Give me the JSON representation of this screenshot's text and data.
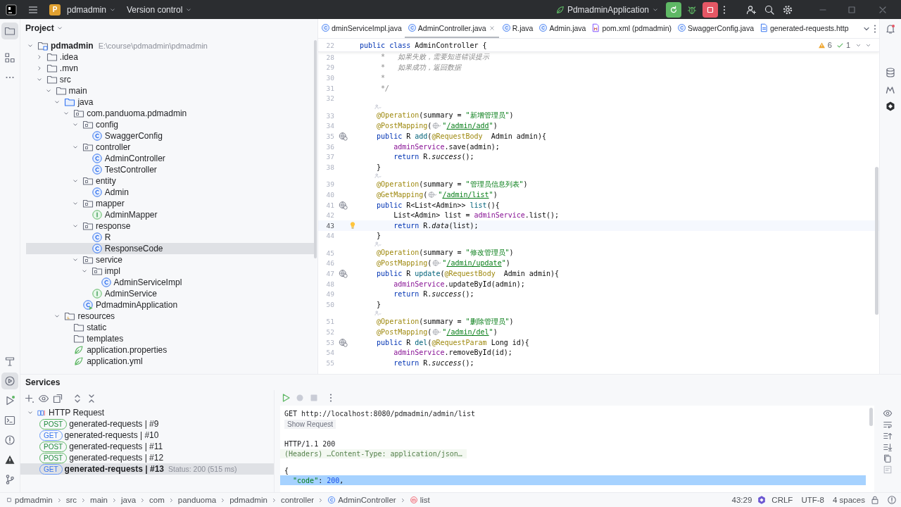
{
  "titlebar": {
    "project_initial": "P",
    "project": "pdmadmin",
    "vcs": "Version control",
    "run_config": "PdmadminApplication"
  },
  "project": {
    "title": "Project",
    "tree": [
      {
        "name": "pdmadmin",
        "path": "E:\\course\\pdmadmin\\pdmadmin",
        "kind": "module",
        "expanded": true,
        "selected": false,
        "children": [
          {
            "name": ".idea",
            "kind": "folder",
            "expanded": false,
            "selected": false
          },
          {
            "name": ".mvn",
            "kind": "folder",
            "expanded": false,
            "selected": false
          },
          {
            "name": "src",
            "kind": "folder",
            "expanded": true,
            "selected": false,
            "children": [
              {
                "name": "main",
                "kind": "folder",
                "expanded": true,
                "selected": false,
                "children": [
                  {
                    "name": "java",
                    "kind": "source",
                    "expanded": true,
                    "selected": false,
                    "children": [
                      {
                        "name": "com.panduoma.pdmadmin",
                        "kind": "package",
                        "expanded": true,
                        "selected": false,
                        "children": [
                          {
                            "name": "config",
                            "kind": "package",
                            "expanded": true,
                            "selected": false,
                            "children": [
                              {
                                "name": "SwaggerConfig",
                                "kind": "class",
                                "selected": false
                              }
                            ]
                          },
                          {
                            "name": "controller",
                            "kind": "package",
                            "expanded": true,
                            "selected": false,
                            "children": [
                              {
                                "name": "AdminController",
                                "kind": "class",
                                "selected": false
                              },
                              {
                                "name": "TestController",
                                "kind": "class",
                                "selected": false
                              }
                            ]
                          },
                          {
                            "name": "entity",
                            "kind": "package",
                            "expanded": true,
                            "selected": false,
                            "children": [
                              {
                                "name": "Admin",
                                "kind": "class",
                                "selected": false
                              }
                            ]
                          },
                          {
                            "name": "mapper",
                            "kind": "package",
                            "expanded": true,
                            "selected": false,
                            "children": [
                              {
                                "name": "AdminMapper",
                                "kind": "interface",
                                "selected": false
                              }
                            ]
                          },
                          {
                            "name": "response",
                            "kind": "package",
                            "expanded": true,
                            "selected": false,
                            "children": [
                              {
                                "name": "R",
                                "kind": "class",
                                "selected": false
                              },
                              {
                                "name": "ResponseCode",
                                "kind": "class",
                                "selected": true
                              }
                            ]
                          },
                          {
                            "name": "service",
                            "kind": "package",
                            "expanded": true,
                            "selected": false,
                            "children": [
                              {
                                "name": "impl",
                                "kind": "package",
                                "expanded": true,
                                "selected": false,
                                "children": [
                                  {
                                    "name": "AdminServiceImpl",
                                    "kind": "class",
                                    "selected": false
                                  }
                                ]
                              },
                              {
                                "name": "AdminService",
                                "kind": "interface",
                                "selected": false
                              }
                            ]
                          },
                          {
                            "name": "PdmadminApplication",
                            "kind": "app",
                            "selected": false
                          }
                        ]
                      }
                    ]
                  },
                  {
                    "name": "resources",
                    "kind": "resources",
                    "expanded": true,
                    "selected": false,
                    "children": [
                      {
                        "name": "static",
                        "kind": "folder",
                        "selected": false
                      },
                      {
                        "name": "templates",
                        "kind": "folder",
                        "selected": false
                      },
                      {
                        "name": "application.properties",
                        "kind": "config",
                        "selected": false
                      },
                      {
                        "name": "application.yml",
                        "kind": "config",
                        "selected": false
                      }
                    ]
                  }
                ]
              }
            ]
          }
        ]
      }
    ]
  },
  "editor": {
    "tabs": [
      {
        "label": "dminServiceImpl.java",
        "kind": "class",
        "selected": false
      },
      {
        "label": "AdminController.java",
        "kind": "class",
        "selected": true
      },
      {
        "label": "R.java",
        "kind": "class",
        "selected": false
      },
      {
        "label": "Admin.java",
        "kind": "class",
        "selected": false
      },
      {
        "label": "pom.xml (pdmadmin)",
        "kind": "build",
        "selected": false
      },
      {
        "label": "SwaggerConfig.java",
        "kind": "class",
        "selected": false
      },
      {
        "label": "generated-requests.http",
        "kind": "http",
        "selected": false
      }
    ],
    "inspections": [
      {
        "kind": "warning",
        "count": "6"
      },
      {
        "kind": "ok",
        "count": "1"
      }
    ],
    "sticky": {
      "number": "22",
      "tokens": [
        {
          "kind": "kw",
          "text": "public class "
        },
        {
          "kind": "pl",
          "text": "AdminController {"
        }
      ]
    },
    "lines": [
      {
        "kind": "code",
        "number": "28",
        "current": false,
        "tokens": [
          {
            "kind": "cm",
            "text": "     *   如果失败，需要知道错误提示"
          }
        ]
      },
      {
        "kind": "code",
        "number": "29",
        "current": false,
        "tokens": [
          {
            "kind": "cm",
            "text": "     *   如果成功，返回数据"
          }
        ]
      },
      {
        "kind": "code",
        "number": "30",
        "current": false,
        "tokens": [
          {
            "kind": "cm",
            "text": "     *"
          }
        ]
      },
      {
        "kind": "code",
        "number": "31",
        "current": false,
        "tokens": [
          {
            "kind": "cm",
            "text": "     */"
          }
        ]
      },
      {
        "kind": "code",
        "number": "32",
        "current": false
      },
      {
        "kind": "inlay"
      },
      {
        "kind": "code",
        "number": "33",
        "current": false,
        "tokens": [
          {
            "kind": "an",
            "text": "    @Operation"
          },
          {
            "kind": "pl",
            "text": "(summary = "
          },
          {
            "kind": "st",
            "text": "\"新增管理员\""
          },
          {
            "kind": "pl",
            "text": ")"
          }
        ]
      },
      {
        "kind": "code",
        "number": "34",
        "current": false,
        "tokens": [
          {
            "kind": "an",
            "text": "    @PostMapping"
          },
          {
            "kind": "pl",
            "text": "("
          },
          {
            "kind": "globe"
          },
          {
            "kind": "st",
            "text": "\""
          },
          {
            "kind": "ln",
            "text": "/admin/add"
          },
          {
            "kind": "st",
            "text": "\""
          },
          {
            "kind": "pl",
            "text": ")"
          }
        ]
      },
      {
        "kind": "code",
        "number": "35",
        "current": false,
        "gutter": {
          "kind": "endpoint"
        },
        "tokens": [
          {
            "kind": "kw",
            "text": "    public "
          },
          {
            "kind": "pl",
            "text": "R "
          },
          {
            "kind": "fn",
            "text": "add"
          },
          {
            "kind": "pl",
            "text": "("
          },
          {
            "kind": "an",
            "text": "@RequestBody"
          },
          {
            "kind": "pl",
            "text": "  Admin admin){"
          }
        ]
      },
      {
        "kind": "code",
        "number": "36",
        "current": false,
        "tokens": [
          {
            "kind": "fd",
            "text": "        adminService"
          },
          {
            "kind": "pl",
            "text": ".save(admin);"
          }
        ]
      },
      {
        "kind": "code",
        "number": "37",
        "current": false,
        "tokens": [
          {
            "kind": "kw",
            "text": "        return "
          },
          {
            "kind": "pl",
            "text": "R."
          },
          {
            "kind": "it",
            "text": "success"
          },
          {
            "kind": "pl",
            "text": "();"
          }
        ]
      },
      {
        "kind": "code",
        "number": "38",
        "current": false,
        "tokens": [
          {
            "kind": "pl",
            "text": "    }"
          }
        ]
      },
      {
        "kind": "inlay"
      },
      {
        "kind": "code",
        "number": "39",
        "current": false,
        "tokens": [
          {
            "kind": "an",
            "text": "    @Operation"
          },
          {
            "kind": "pl",
            "text": "(summary = "
          },
          {
            "kind": "st",
            "text": "\"管理员信息列表\""
          },
          {
            "kind": "pl",
            "text": ")"
          }
        ]
      },
      {
        "kind": "code",
        "number": "40",
        "current": false,
        "tokens": [
          {
            "kind": "an",
            "text": "    @GetMapping"
          },
          {
            "kind": "pl",
            "text": "("
          },
          {
            "kind": "globe"
          },
          {
            "kind": "st",
            "text": "\""
          },
          {
            "kind": "ln",
            "text": "/admin/list"
          },
          {
            "kind": "st",
            "text": "\""
          },
          {
            "kind": "pl",
            "text": ")"
          }
        ]
      },
      {
        "kind": "code",
        "number": "41",
        "current": false,
        "gutter": {
          "kind": "endpoint"
        },
        "tokens": [
          {
            "kind": "kw",
            "text": "    public "
          },
          {
            "kind": "pl",
            "text": "R<List<Admin>> "
          },
          {
            "kind": "fn",
            "text": "list"
          },
          {
            "kind": "pl",
            "text": "(){"
          }
        ]
      },
      {
        "kind": "code",
        "number": "42",
        "current": false,
        "tokens": [
          {
            "kind": "pl",
            "text": "        List<Admin> list = "
          },
          {
            "kind": "fd",
            "text": "adminService"
          },
          {
            "kind": "pl",
            "text": ".list();"
          }
        ]
      },
      {
        "kind": "code",
        "number": "43",
        "current": true,
        "gutter": {
          "kind": "bulb"
        },
        "tokens": [
          {
            "kind": "kw",
            "text": "        return "
          },
          {
            "kind": "pl",
            "text": "R."
          },
          {
            "kind": "it",
            "text": "data"
          },
          {
            "kind": "pl",
            "text": "(list);"
          }
        ]
      },
      {
        "kind": "code",
        "number": "44",
        "current": false,
        "tokens": [
          {
            "kind": "pl",
            "text": "    }"
          }
        ]
      },
      {
        "kind": "inlay"
      },
      {
        "kind": "code",
        "number": "45",
        "current": false,
        "tokens": [
          {
            "kind": "an",
            "text": "    @Operation"
          },
          {
            "kind": "pl",
            "text": "(summary = "
          },
          {
            "kind": "st",
            "text": "\"修改管理员\""
          },
          {
            "kind": "pl",
            "text": ")"
          }
        ]
      },
      {
        "kind": "code",
        "number": "46",
        "current": false,
        "tokens": [
          {
            "kind": "an",
            "text": "    @PostMapping"
          },
          {
            "kind": "pl",
            "text": "("
          },
          {
            "kind": "globe"
          },
          {
            "kind": "st",
            "text": "\""
          },
          {
            "kind": "ln",
            "text": "/admin/update"
          },
          {
            "kind": "st",
            "text": "\""
          },
          {
            "kind": "pl",
            "text": ")"
          }
        ]
      },
      {
        "kind": "code",
        "number": "47",
        "current": false,
        "gutter": {
          "kind": "endpoint"
        },
        "tokens": [
          {
            "kind": "kw",
            "text": "    public "
          },
          {
            "kind": "pl",
            "text": "R "
          },
          {
            "kind": "fn",
            "text": "update"
          },
          {
            "kind": "pl",
            "text": "("
          },
          {
            "kind": "an",
            "text": "@RequestBody"
          },
          {
            "kind": "pl",
            "text": "  Admin admin){"
          }
        ]
      },
      {
        "kind": "code",
        "number": "48",
        "current": false,
        "tokens": [
          {
            "kind": "fd",
            "text": "        adminService"
          },
          {
            "kind": "pl",
            "text": ".updateById(admin);"
          }
        ]
      },
      {
        "kind": "code",
        "number": "49",
        "current": false,
        "tokens": [
          {
            "kind": "kw",
            "text": "        return "
          },
          {
            "kind": "pl",
            "text": "R."
          },
          {
            "kind": "it",
            "text": "success"
          },
          {
            "kind": "pl",
            "text": "();"
          }
        ]
      },
      {
        "kind": "code",
        "number": "50",
        "current": false,
        "tokens": [
          {
            "kind": "pl",
            "text": "    }"
          }
        ]
      },
      {
        "kind": "inlay"
      },
      {
        "kind": "code",
        "number": "51",
        "current": false,
        "tokens": [
          {
            "kind": "an",
            "text": "    @Operation"
          },
          {
            "kind": "pl",
            "text": "(summary = "
          },
          {
            "kind": "st",
            "text": "\"删除管理员\""
          },
          {
            "kind": "pl",
            "text": ")"
          }
        ]
      },
      {
        "kind": "code",
        "number": "52",
        "current": false,
        "tokens": [
          {
            "kind": "an",
            "text": "    @PostMapping"
          },
          {
            "kind": "pl",
            "text": "("
          },
          {
            "kind": "globe"
          },
          {
            "kind": "st",
            "text": "\""
          },
          {
            "kind": "ln",
            "text": "/admin/del"
          },
          {
            "kind": "st",
            "text": "\""
          },
          {
            "kind": "pl",
            "text": ")"
          }
        ]
      },
      {
        "kind": "code",
        "number": "53",
        "current": false,
        "gutter": {
          "kind": "endpoint"
        },
        "tokens": [
          {
            "kind": "kw",
            "text": "    public "
          },
          {
            "kind": "pl",
            "text": "R "
          },
          {
            "kind": "fn",
            "text": "del"
          },
          {
            "kind": "pl",
            "text": "("
          },
          {
            "kind": "an",
            "text": "@RequestParam"
          },
          {
            "kind": "pl",
            "text": " Long id){"
          }
        ]
      },
      {
        "kind": "code",
        "number": "54",
        "current": false,
        "tokens": [
          {
            "kind": "fd",
            "text": "        adminService"
          },
          {
            "kind": "pl",
            "text": ".removeById(id);"
          }
        ]
      },
      {
        "kind": "code",
        "number": "55",
        "current": false,
        "tokens": [
          {
            "kind": "kw",
            "text": "        return "
          },
          {
            "kind": "pl",
            "text": "R."
          },
          {
            "kind": "it",
            "text": "success"
          },
          {
            "kind": "pl",
            "text": "();"
          }
        ]
      }
    ]
  },
  "services": {
    "title": "Services",
    "tree": [
      {
        "label": "HTTP Request",
        "expanded": true,
        "children": [
          {
            "method": "POST",
            "kind": "post",
            "label": "generated-requests  |  #9",
            "selected": false
          },
          {
            "method": "GET",
            "kind": "get",
            "label": "generated-requests  |  #10",
            "selected": false
          },
          {
            "method": "POST",
            "kind": "post",
            "label": "generated-requests  |  #11",
            "selected": false
          },
          {
            "method": "POST",
            "kind": "post",
            "label": "generated-requests  |  #12",
            "selected": false
          },
          {
            "method": "GET",
            "kind": "get",
            "label": "generated-requests  |  #13",
            "status": "Status: 200 (515 ms)",
            "selected": true
          }
        ]
      }
    ],
    "response": [
      {
        "kind": "request",
        "text": "GET http://localhost:8080/pdmadmin/admin/list"
      },
      {
        "kind": "button",
        "text": "Show Request"
      },
      {
        "kind": "status",
        "text": "HTTP/1.1 200"
      },
      {
        "kind": "headers",
        "text": "(Headers) …Content-Type: application/json…"
      },
      {
        "kind": "json",
        "selected": false,
        "tokens": [
          {
            "kind": "pl",
            "text": "{"
          }
        ]
      },
      {
        "kind": "json",
        "selected": true,
        "tokens": [
          {
            "kind": "st",
            "text": "  \"code\""
          },
          {
            "kind": "pl",
            "text": ": "
          },
          {
            "kind": "nu",
            "text": "200"
          },
          {
            "kind": "pl",
            "text": ","
          }
        ]
      }
    ]
  },
  "status_bar": {
    "breadcrumbs": [
      {
        "label": "pdmadmin",
        "kind": "module"
      },
      {
        "label": "src",
        "kind": "folder"
      },
      {
        "label": "main",
        "kind": "folder"
      },
      {
        "label": "java",
        "kind": "folder"
      },
      {
        "label": "com",
        "kind": "folder"
      },
      {
        "label": "panduoma",
        "kind": "folder"
      },
      {
        "label": "pdmadmin",
        "kind": "folder"
      },
      {
        "label": "controller",
        "kind": "folder"
      },
      {
        "label": "AdminController",
        "kind": "class"
      },
      {
        "label": "list",
        "kind": "method"
      }
    ],
    "position": "43:29",
    "line_separator": "CRLF",
    "encoding": "UTF-8",
    "indent": "4 spaces"
  }
}
